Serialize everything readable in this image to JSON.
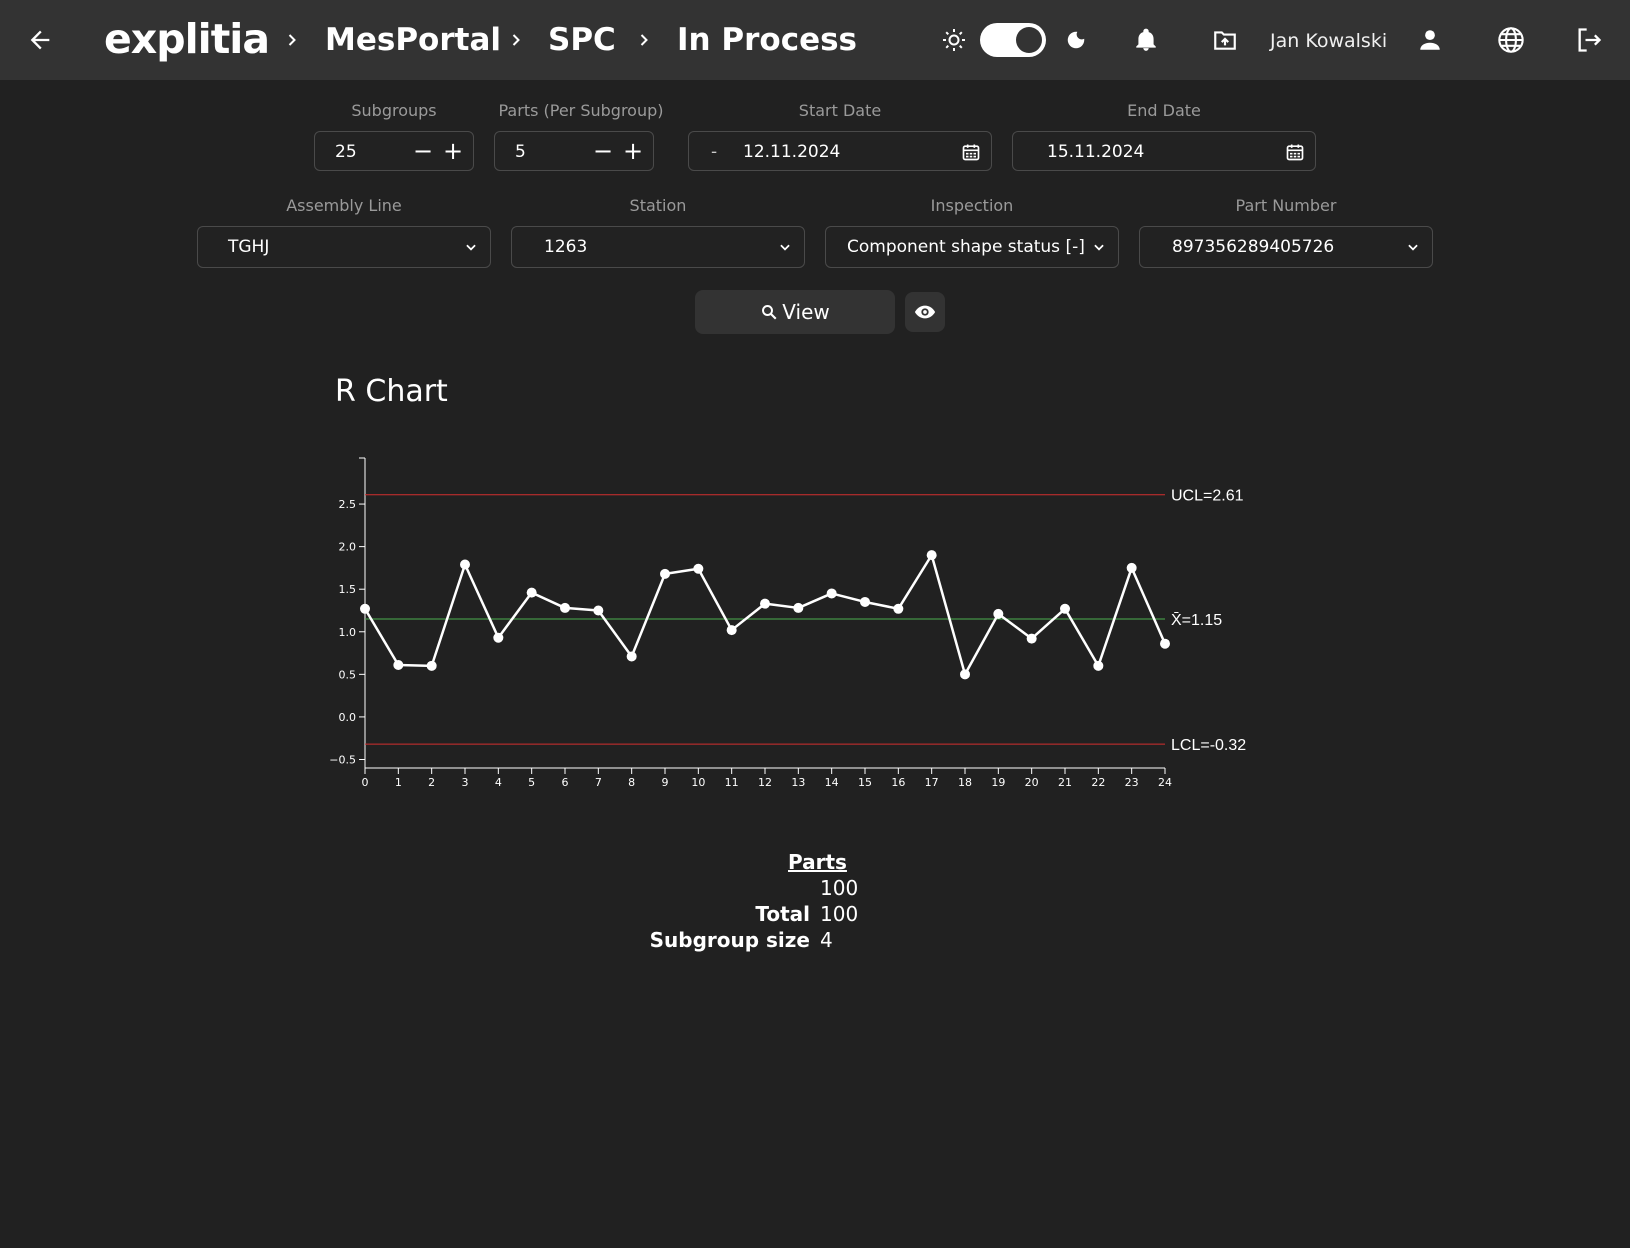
{
  "header": {
    "logo": "explitia",
    "breadcrumbs": [
      "MesPortal",
      "SPC",
      "In Process"
    ],
    "user_name": "Jan Kowalski"
  },
  "filters": {
    "subgroups": {
      "label": "Subgroups",
      "value": "25"
    },
    "parts": {
      "label": "Parts (Per Subgroup)",
      "value": "5"
    },
    "start_date": {
      "label": "Start Date",
      "prefix": "-",
      "value": "12.11.2024"
    },
    "end_date": {
      "label": "End Date",
      "value": "15.11.2024"
    },
    "assembly_line": {
      "label": "Assembly Line",
      "value": "TGHJ"
    },
    "station": {
      "label": "Station",
      "value": "1263"
    },
    "inspection": {
      "label": "Inspection",
      "value": "Component shape status [-]"
    },
    "part_number": {
      "label": "Part Number",
      "value": "897356289405726"
    },
    "view_label": "View"
  },
  "chart_title": "R Chart",
  "chart_data": {
    "type": "line",
    "x": [
      0,
      1,
      2,
      3,
      4,
      5,
      6,
      7,
      8,
      9,
      10,
      11,
      12,
      13,
      14,
      15,
      16,
      17,
      18,
      19,
      20,
      21,
      22,
      23,
      24
    ],
    "values": [
      1.27,
      0.61,
      0.6,
      1.79,
      0.93,
      1.46,
      1.28,
      1.25,
      0.71,
      1.68,
      1.74,
      1.02,
      1.33,
      1.28,
      1.45,
      1.35,
      1.27,
      1.9,
      0.5,
      1.21,
      0.92,
      1.27,
      0.6,
      1.75,
      0.86
    ],
    "ylim": [
      -0.6,
      2.9
    ],
    "yticks": [
      -0.5,
      0.0,
      0.5,
      1.0,
      1.5,
      2.0,
      2.5
    ],
    "ytick_labels": [
      "−0.5",
      "0.0",
      "0.5",
      "1.0",
      "1.5",
      "2.0",
      "2.5"
    ],
    "xticks": [
      "0",
      "1",
      "2",
      "3",
      "4",
      "5",
      "6",
      "7",
      "8",
      "9",
      "10",
      "11",
      "12",
      "13",
      "14",
      "15",
      "16",
      "17",
      "18",
      "19",
      "20",
      "21",
      "22",
      "23",
      "24"
    ],
    "control_lines": [
      {
        "name": "UCL",
        "value": 2.61,
        "label": "UCL=2.61",
        "color": "#d32f2f"
      },
      {
        "name": "center",
        "value": 1.15,
        "label": "X̄=1.15",
        "color": "#4caf50"
      },
      {
        "name": "LCL",
        "value": -0.32,
        "label": "LCL=-0.32",
        "color": "#d32f2f"
      }
    ],
    "line_color": "#ffffff"
  },
  "stats": {
    "header": "Parts",
    "rows": [
      {
        "label": "",
        "value": "100"
      },
      {
        "label": "Total",
        "value": "100"
      },
      {
        "label": "Subgroup size",
        "value": "4"
      }
    ]
  }
}
